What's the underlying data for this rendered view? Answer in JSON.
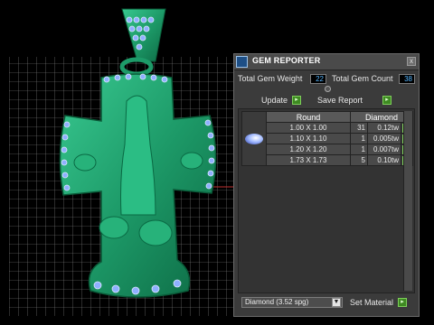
{
  "panel": {
    "title": "GEM REPORTER",
    "close_glyph": "x",
    "total_weight_label": "Total Gem Weight",
    "total_weight_value": "22",
    "total_count_label": "Total Gem Count",
    "total_count_value": "38",
    "update_label": "Update",
    "save_report_label": "Save Report",
    "go_glyph": "▸",
    "table": {
      "shape_header": "Round",
      "material_header": "Diamond",
      "rows": [
        {
          "size": "1.00 X 1.00",
          "count": "31",
          "weight": "0.12tw"
        },
        {
          "size": "1.10 X 1.10",
          "count": "1",
          "weight": "0.005tw"
        },
        {
          "size": "1.20 X 1.20",
          "count": "1",
          "weight": "0.007tw"
        },
        {
          "size": "1.73 X 1.73",
          "count": "5",
          "weight": "0.10tw"
        }
      ]
    },
    "material_dropdown": "Diamond   (3.52 spg)",
    "set_material_label": "Set Material"
  },
  "colors": {
    "pendant_green": "#1f9b6a",
    "gem_blue": "#8fb0ff",
    "grid_line": "#8a8a8a"
  }
}
